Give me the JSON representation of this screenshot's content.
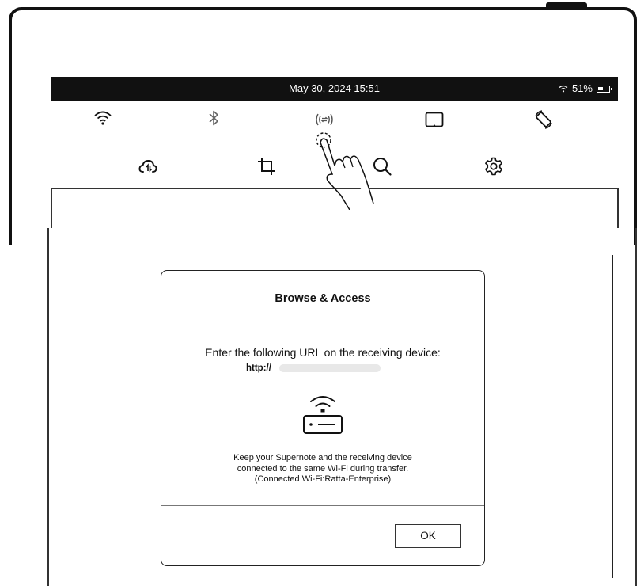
{
  "status_bar": {
    "datetime": "May 30, 2024  15:51",
    "battery": "51%"
  },
  "quick_panel": {
    "row1": [
      "wifi-icon",
      "bluetooth-icon",
      "browse-access-icon",
      "screen-mirror-icon",
      "rotate-screen-icon"
    ],
    "row2": [
      "cloud-sync-icon",
      "crop-screenshot-icon",
      "search-icon",
      "settings-icon"
    ]
  },
  "dialog": {
    "title": "Browse & Access",
    "instruction": "Enter the following URL on the receiving device:",
    "url_prefix": "http://",
    "note_lines": [
      "Keep your Supernote and the receiving device",
      "connected to the same Wi-Fi during transfer.",
      "(Connected Wi-Fi:Ratta-Enterprise)"
    ],
    "ok_label": "OK"
  }
}
